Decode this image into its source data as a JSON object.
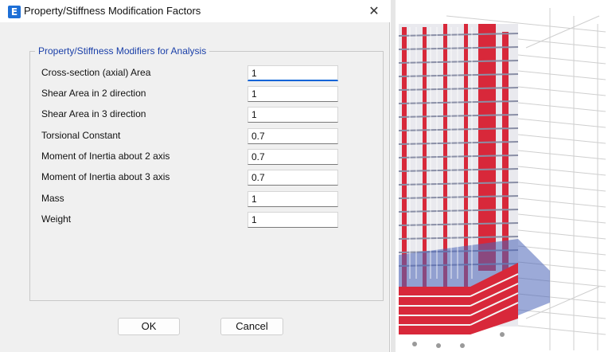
{
  "dialog": {
    "title": "Property/Stiffness Modification Factors",
    "app_icon_glyph": "E",
    "close_glyph": "✕",
    "group_title": "Property/Stiffness Modifiers for Analysis",
    "rows": [
      {
        "label": "Cross-section (axial) Area",
        "value": "1"
      },
      {
        "label": "Shear Area in 2 direction",
        "value": "1"
      },
      {
        "label": "Shear Area in 3 direction",
        "value": "1"
      },
      {
        "label": "Torsional Constant",
        "value": "0.7"
      },
      {
        "label": "Moment of Inertia about 2 axis",
        "value": "0.7"
      },
      {
        "label": "Moment of Inertia about 3 axis",
        "value": "0.7"
      },
      {
        "label": "Mass",
        "value": "1"
      },
      {
        "label": "Weight",
        "value": "1"
      }
    ],
    "ok_label": "OK",
    "cancel_label": "Cancel"
  },
  "colors": {
    "accent": "#0a64d8",
    "group_title": "#1a3fa8",
    "app_icon": "#1e6fd6",
    "building_columns": "#d8283a",
    "building_slabs": "#3f5fb0"
  },
  "viewport": {
    "description_icon": "3d-building-model"
  }
}
